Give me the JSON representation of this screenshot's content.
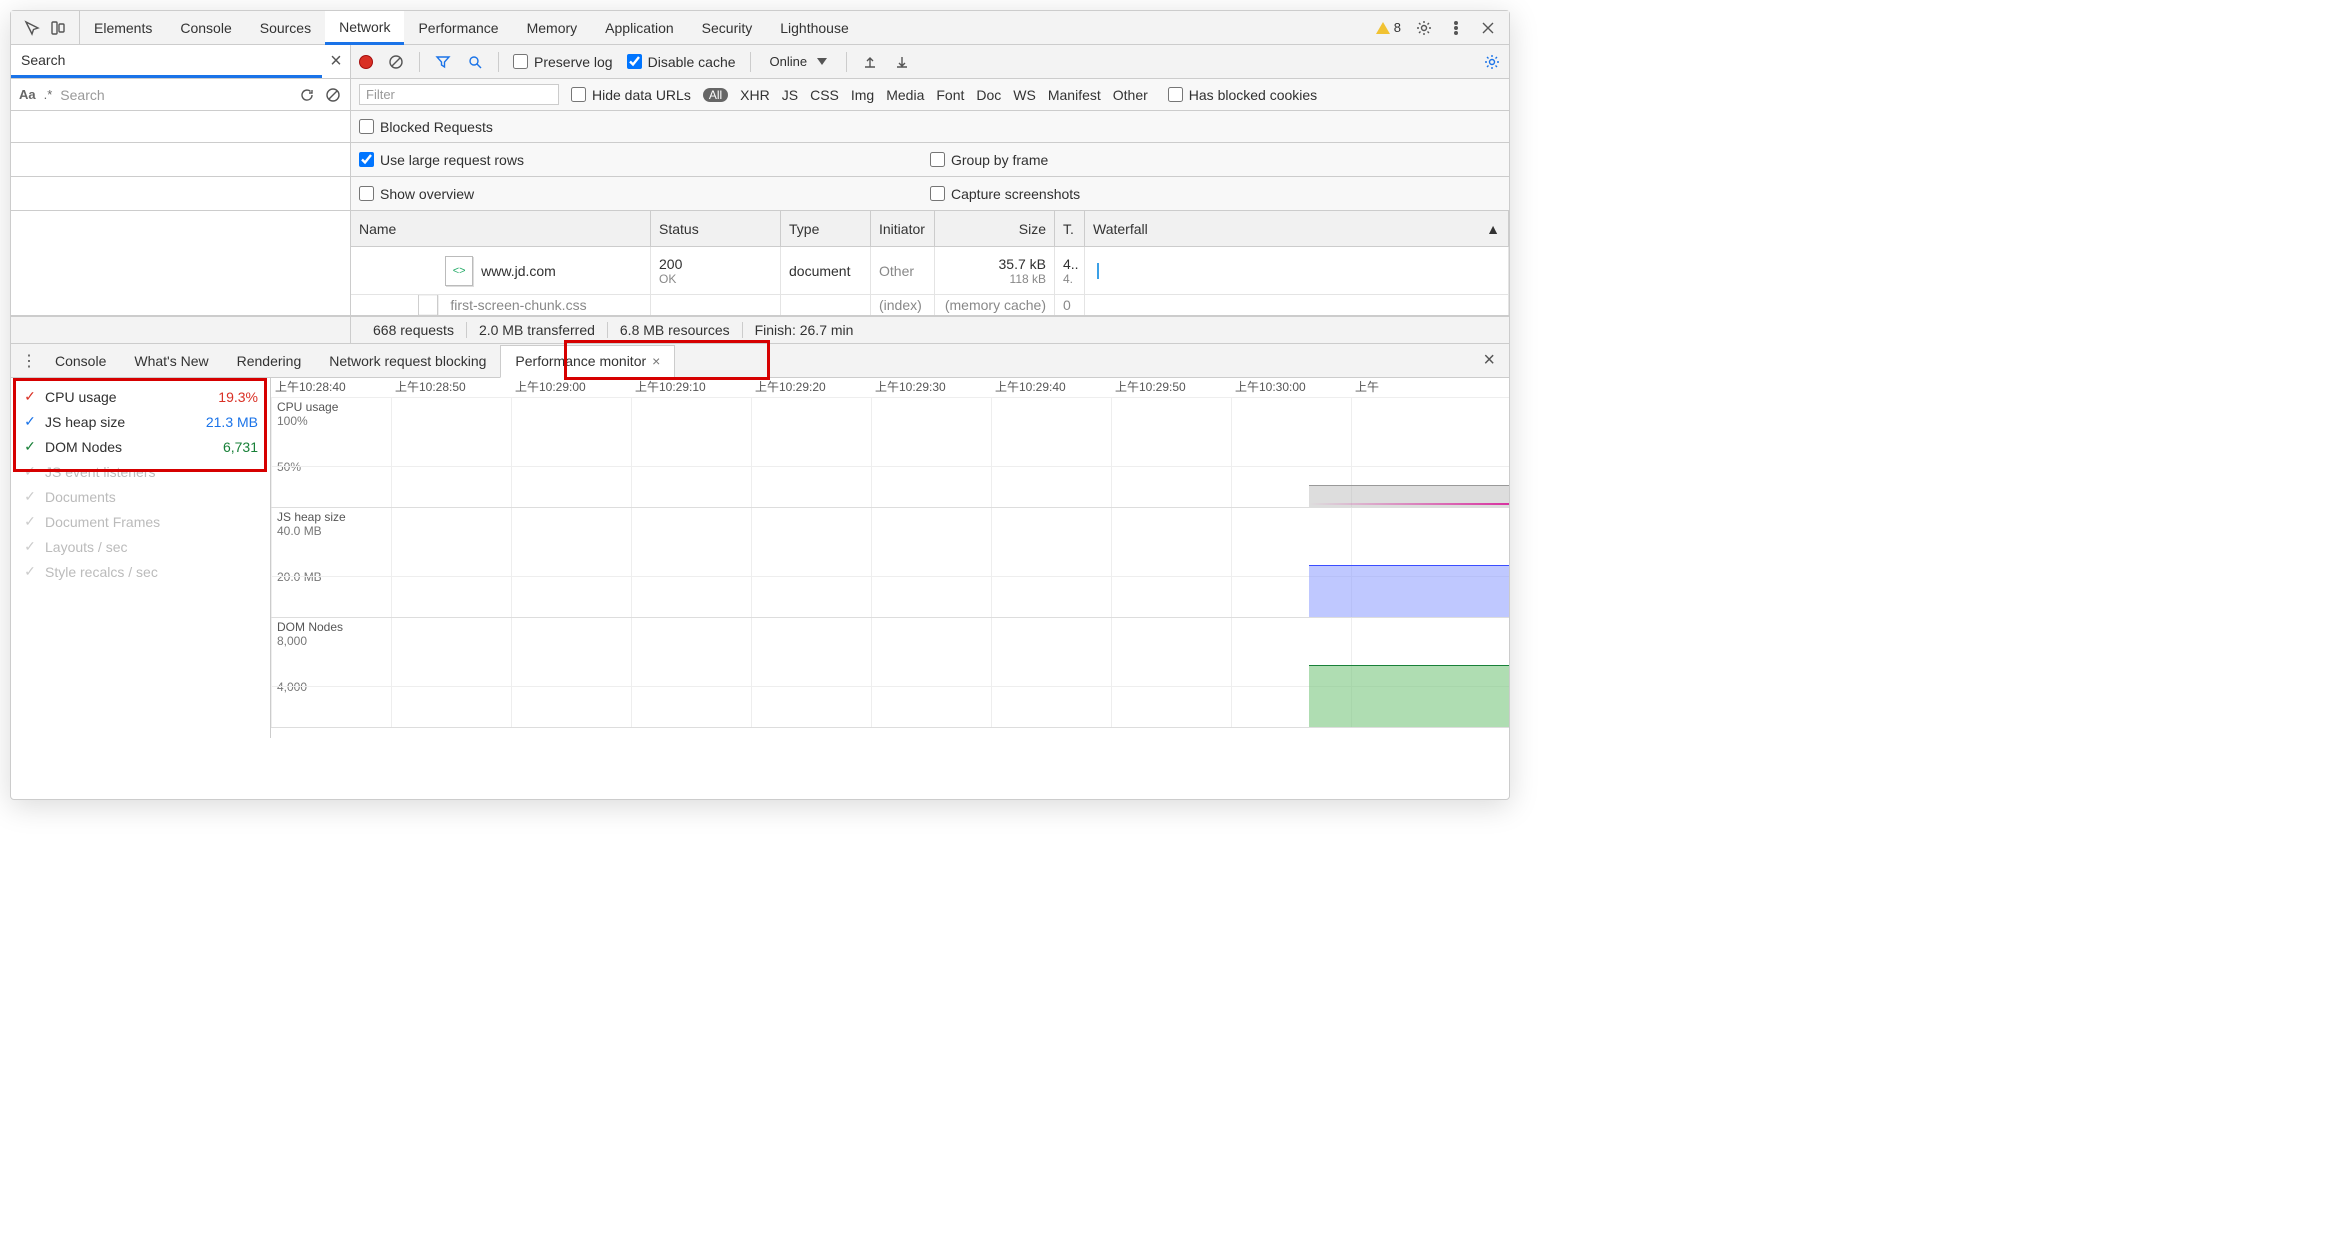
{
  "tabs": {
    "elements": "Elements",
    "console": "Console",
    "sources": "Sources",
    "network": "Network",
    "performance": "Performance",
    "memory": "Memory",
    "application": "Application",
    "security": "Security",
    "lighthouse": "Lighthouse"
  },
  "warnings_count": "8",
  "search": {
    "label": "Search",
    "placeholder": "Search",
    "aa": "Aa",
    "regex": ".*"
  },
  "net_toolbar": {
    "preserve": "Preserve log",
    "disable_cache": "Disable cache",
    "throttle": "Online"
  },
  "filters": {
    "placeholder": "Filter",
    "hide_urls": "Hide data URLs",
    "all": "All",
    "types": [
      "XHR",
      "JS",
      "CSS",
      "Img",
      "Media",
      "Font",
      "Doc",
      "WS",
      "Manifest",
      "Other"
    ],
    "blocked_cookies": "Has blocked cookies",
    "blocked_requests": "Blocked Requests"
  },
  "options": {
    "large_rows": "Use large request rows",
    "group_frame": "Group by frame",
    "show_overview": "Show overview",
    "capture": "Capture screenshots"
  },
  "columns": {
    "name": "Name",
    "status": "Status",
    "type": "Type",
    "initiator": "Initiator",
    "size": "Size",
    "time": "T.",
    "waterfall": "Waterfall"
  },
  "rows": [
    {
      "name": "www.jd.com",
      "status": "200",
      "status_text": "OK",
      "type": "document",
      "initiator": "Other",
      "size": "35.7 kB",
      "size_sub": "118 kB",
      "time": "4..",
      "time_sub": "4."
    },
    {
      "name": "first-screen-chunk.css",
      "initiator": "(index)",
      "size": "(memory cache)",
      "time": "0"
    }
  ],
  "summary": {
    "requests": "668 requests",
    "transferred": "2.0 MB transferred",
    "resources": "6.8 MB resources",
    "finish": "Finish: 26.7 min"
  },
  "drawer": {
    "console": "Console",
    "whatsnew": "What's New",
    "rendering": "Rendering",
    "blocking": "Network request blocking",
    "perfmon": "Performance monitor"
  },
  "pm_metrics": [
    {
      "label": "CPU usage",
      "value": "19.3%",
      "color": "c-red",
      "on": true
    },
    {
      "label": "JS heap size",
      "value": "21.3 MB",
      "color": "c-blue",
      "on": true
    },
    {
      "label": "DOM Nodes",
      "value": "6,731",
      "color": "c-green",
      "on": true
    },
    {
      "label": "JS event listeners",
      "value": "",
      "color": "",
      "on": false
    },
    {
      "label": "Documents",
      "value": "",
      "color": "",
      "on": false
    },
    {
      "label": "Document Frames",
      "value": "",
      "color": "",
      "on": false
    },
    {
      "label": "Layouts / sec",
      "value": "",
      "color": "",
      "on": false
    },
    {
      "label": "Style recalcs / sec",
      "value": "",
      "color": "",
      "on": false
    }
  ],
  "time_labels": [
    "上午10:28:40",
    "上午10:28:50",
    "上午10:29:00",
    "上午10:29:10",
    "上午10:29:20",
    "上午10:29:30",
    "上午10:29:40",
    "上午10:29:50",
    "上午10:30:00",
    "上午"
  ],
  "charts": {
    "cpu": {
      "title": "CPU usage",
      "y1": "100%",
      "y2": "50%"
    },
    "js": {
      "title": "JS heap size",
      "y1": "40.0 MB",
      "y2": "20.0 MB"
    },
    "dom": {
      "title": "DOM Nodes",
      "y1": "8,000",
      "y2": "4,000"
    }
  },
  "chart_data": [
    {
      "type": "area",
      "title": "CPU usage",
      "ylabel": "%",
      "ylim": [
        0,
        100
      ],
      "x": [
        "10:29:50",
        "10:30:00"
      ],
      "series": [
        {
          "name": "CPU usage",
          "values": [
            18,
            19.3
          ]
        }
      ]
    },
    {
      "type": "area",
      "title": "JS heap size",
      "ylabel": "MB",
      "ylim": [
        0,
        40
      ],
      "x": [
        "10:29:50",
        "10:30:00"
      ],
      "series": [
        {
          "name": "JS heap size",
          "values": [
            21.0,
            21.3
          ]
        }
      ]
    },
    {
      "type": "area",
      "title": "DOM Nodes",
      "ylabel": "nodes",
      "ylim": [
        0,
        8000
      ],
      "x": [
        "10:29:50",
        "10:30:00"
      ],
      "series": [
        {
          "name": "DOM Nodes",
          "values": [
            6700,
            6731
          ]
        }
      ]
    }
  ]
}
